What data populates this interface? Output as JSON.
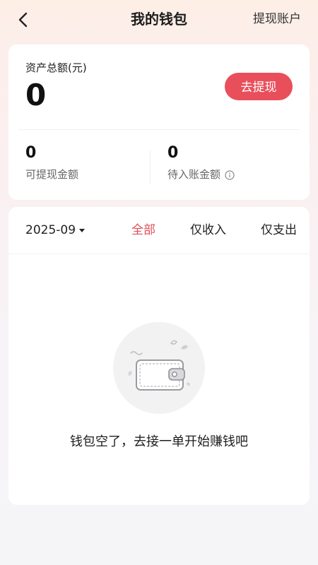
{
  "header": {
    "title": "我的钱包",
    "right_action": "提现账户",
    "back_icon": "chevron-left-icon"
  },
  "assets": {
    "label": "资产总额(元)",
    "total": "0",
    "withdraw_label": "去提现",
    "withdrawable_value": "0",
    "withdrawable_label": "可提现金额",
    "pending_value": "0",
    "pending_label": "待入账金额",
    "info_icon": "info-icon"
  },
  "filters": {
    "month": "2025-09",
    "tabs": [
      "全部",
      "仅收入",
      "仅支出"
    ],
    "active_tab": "全部"
  },
  "empty_state": {
    "message": "钱包空了，去接一单开始赚钱吧",
    "illustration_icon": "empty-wallet-icon"
  },
  "colors": {
    "accent": "#e94f5b",
    "active_tab": "#e04e5a"
  }
}
